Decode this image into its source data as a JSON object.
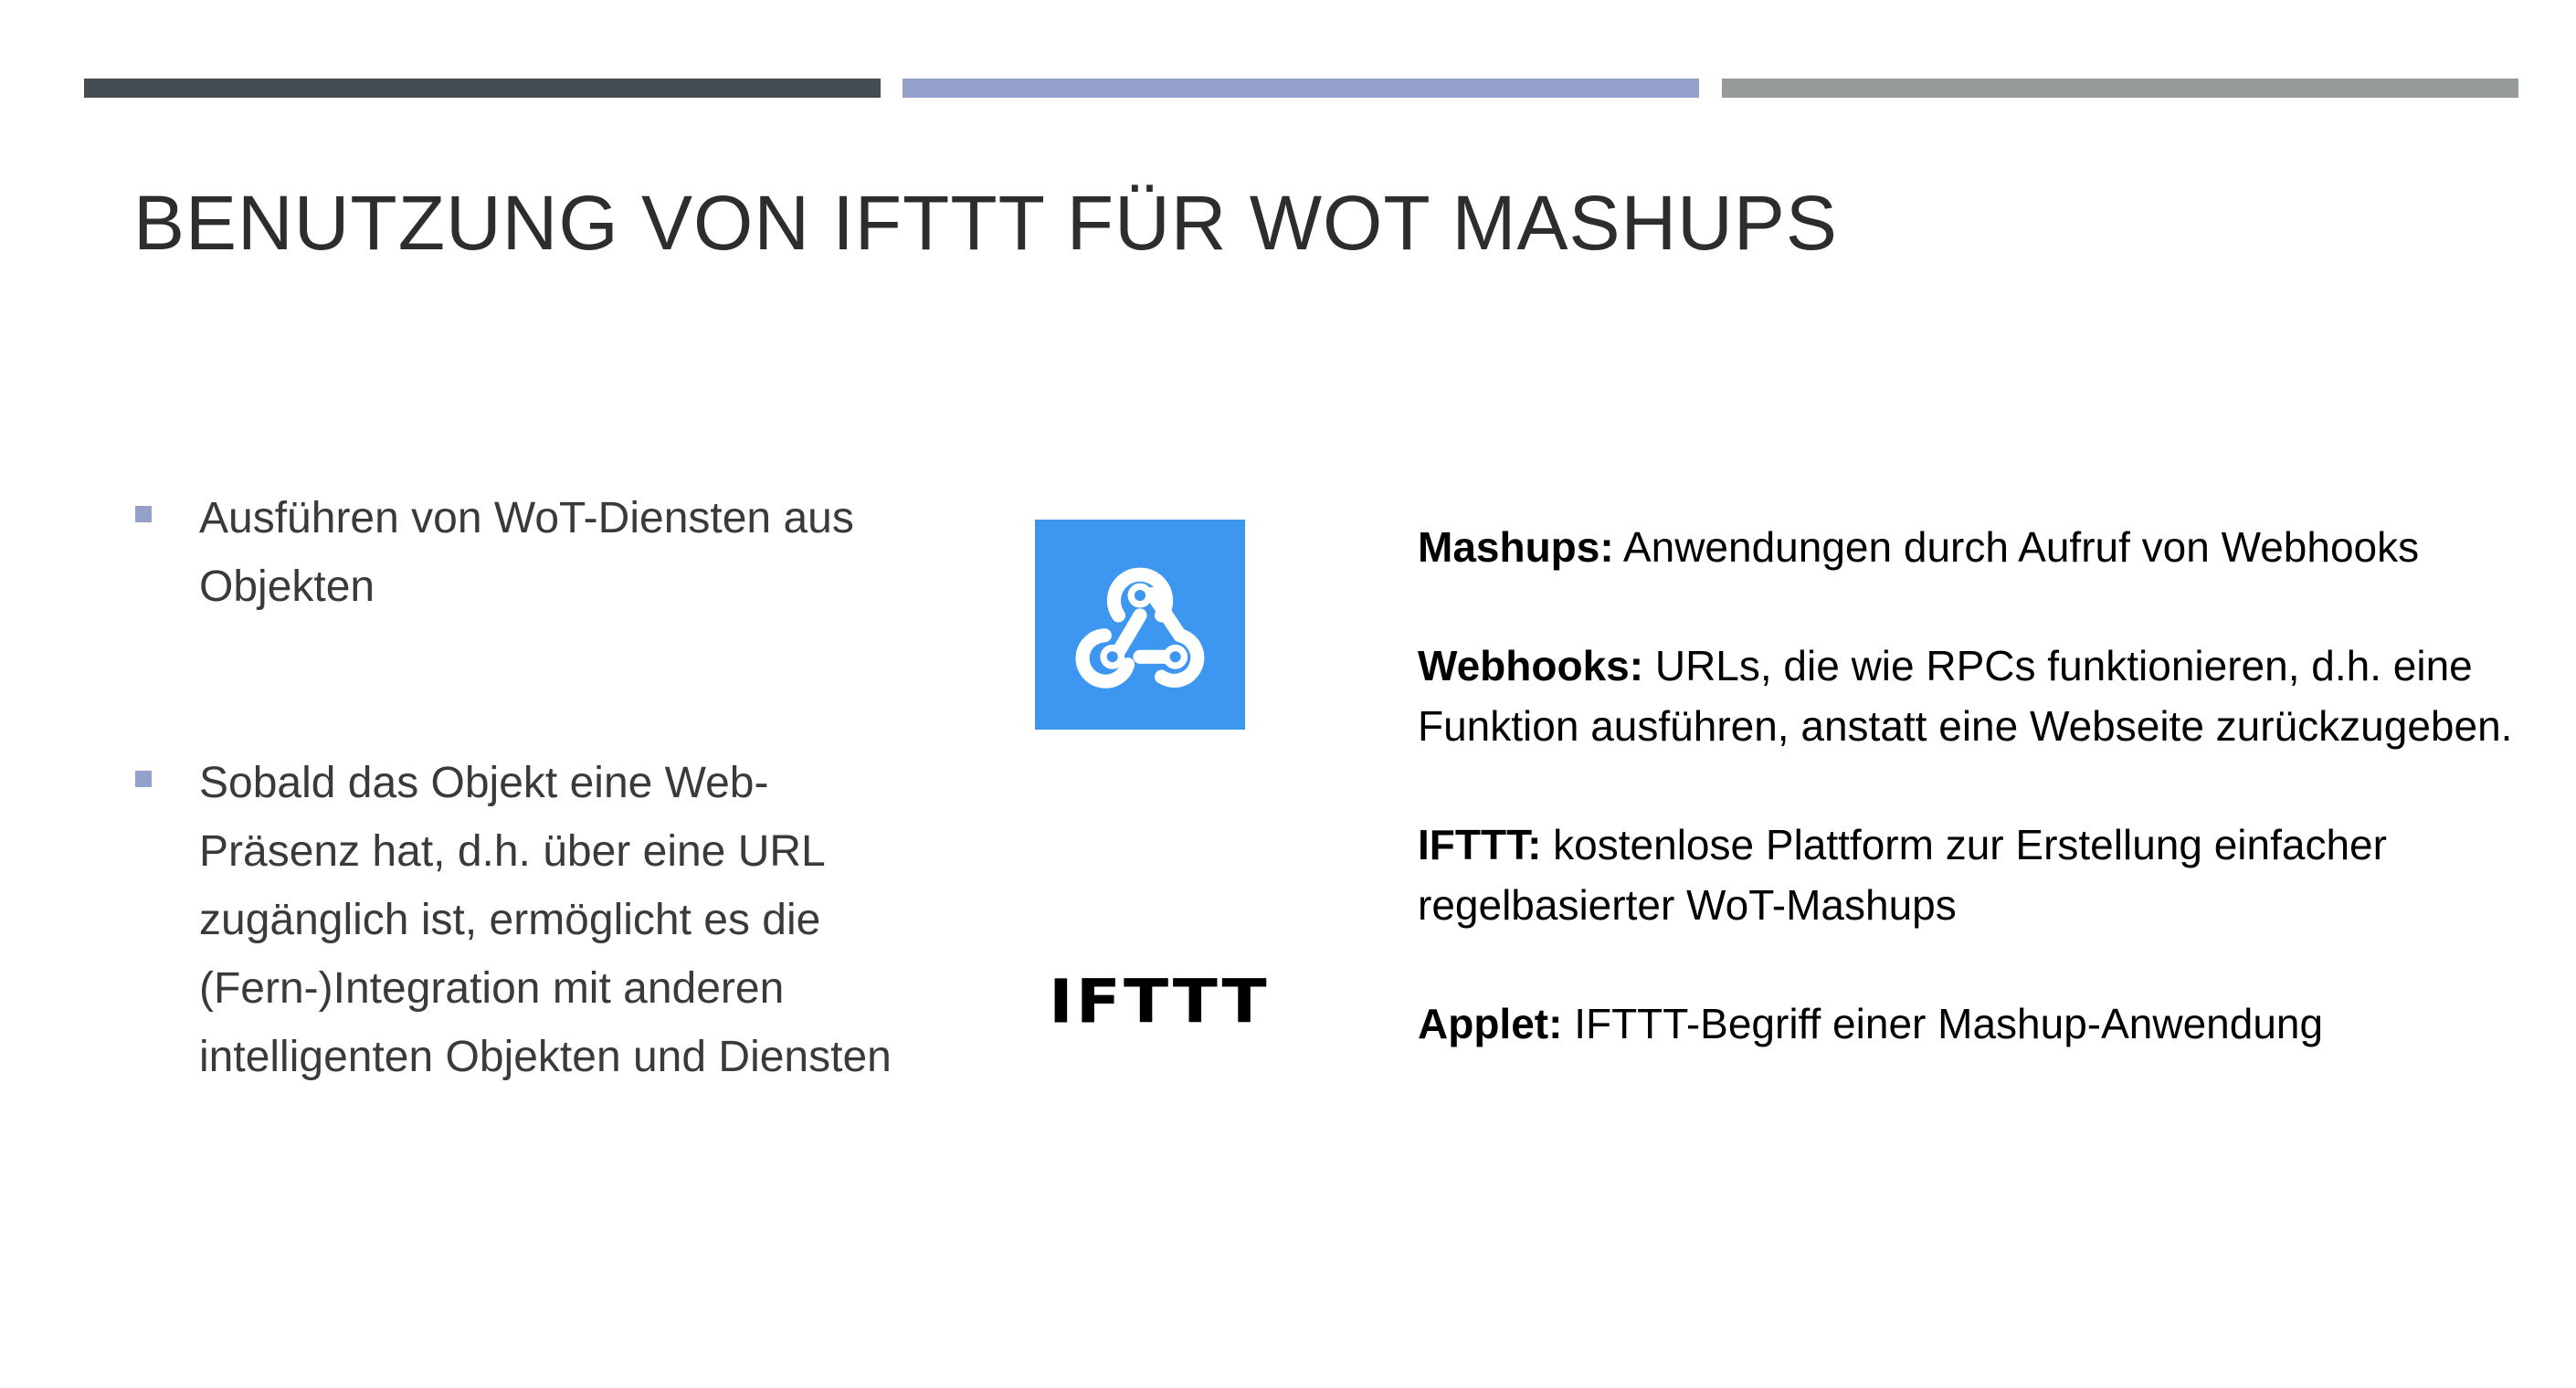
{
  "slide": {
    "title": "BENUTZUNG VON IFTTT FÜR WOT MASHUPS",
    "accent_colors": [
      "#454c52",
      "#95a1cb",
      "#969a9b"
    ],
    "bullets": [
      {
        "text": "Ausführen von WoT-Diensten aus Objekten"
      },
      {
        "text": "Sobald das Objekt eine Web-Präsenz hat, d.h. über eine URL zugänglich ist, ermöglicht es die (Fern-)Integration mit anderen intelligenten Objekten und Diensten"
      }
    ],
    "logos": {
      "webhook": {
        "icon": "webhook-icon",
        "background": "#3d97f0"
      },
      "ifttt": {
        "text": "IFTTT"
      }
    },
    "definitions": [
      {
        "term": "Mashups:",
        "text": " Anwendungen durch Aufruf von Webhooks"
      },
      {
        "term": "Webhooks:",
        "text": " URLs, die wie RPCs funktionieren, d.h. eine Funktion ausführen, anstatt eine Webseite zurückzugeben."
      },
      {
        "term": "IFTTT:",
        "text": " kostenlose Plattform zur Erstellung einfacher regelbasierter WoT-Mashups"
      },
      {
        "term": "Applet:",
        "text": " IFTTT-Begriff einer Mashup-Anwendung"
      }
    ]
  }
}
